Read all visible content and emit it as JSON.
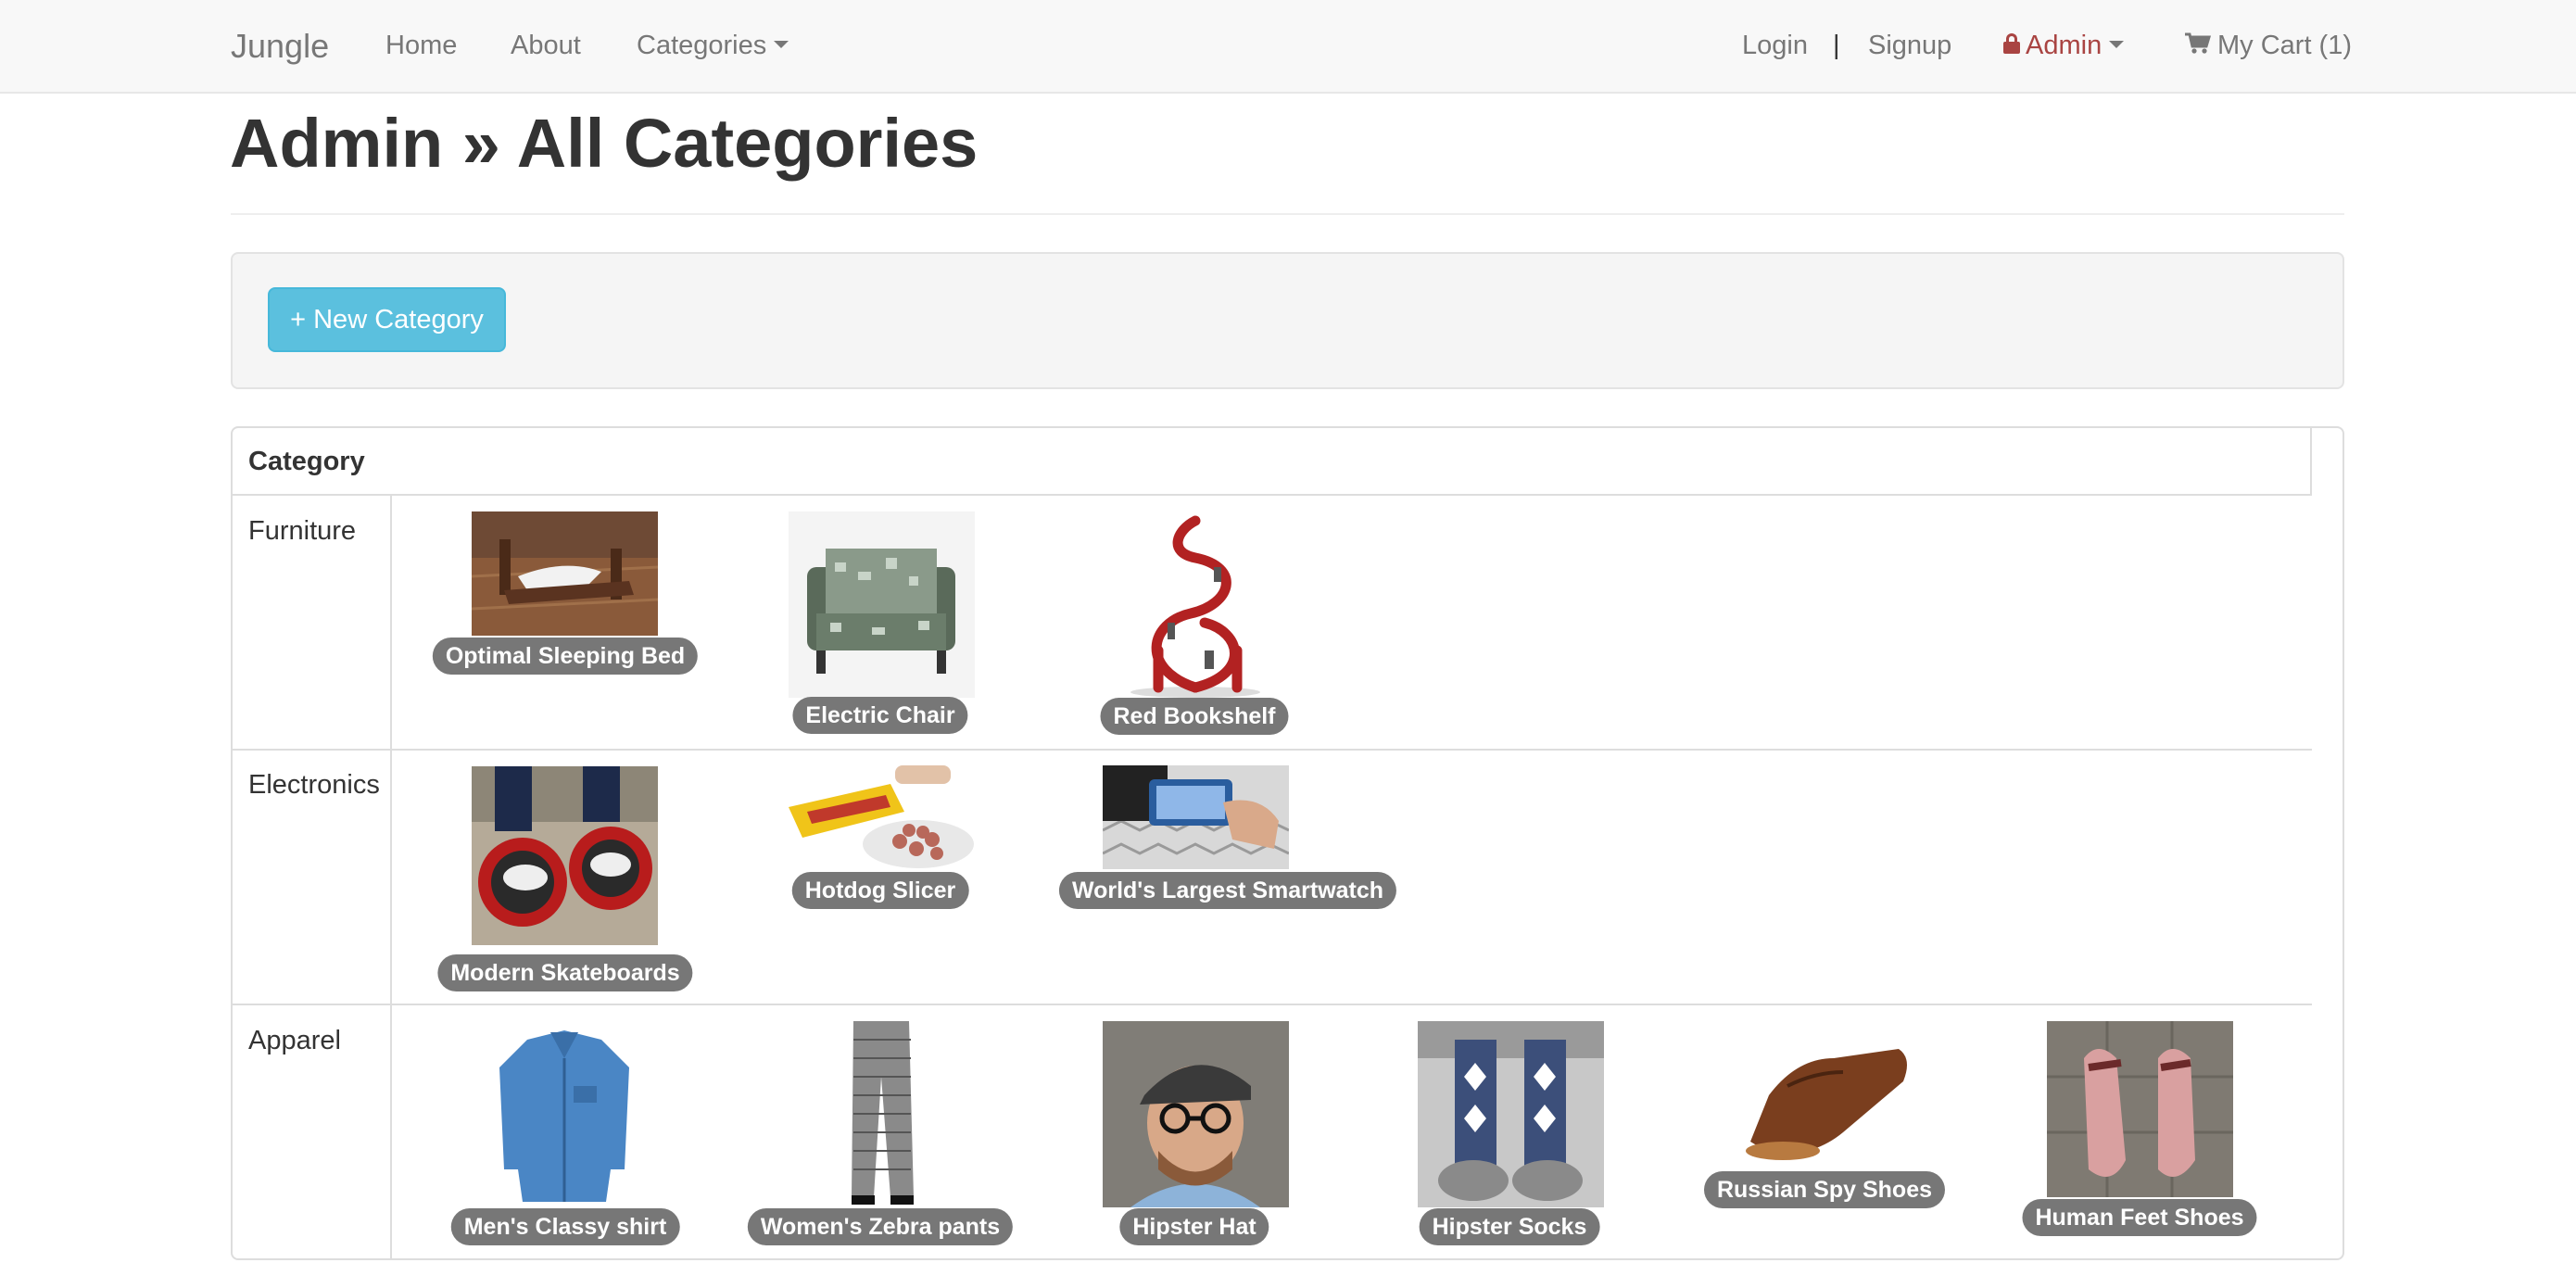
{
  "navbar": {
    "brand": "Jungle",
    "home": "Home",
    "about": "About",
    "categories": "Categories",
    "login": "Login",
    "separator": "|",
    "signup": "Signup",
    "admin": "Admin",
    "cart": "My Cart (1)"
  },
  "page": {
    "title": "Admin » All Categories",
    "new_category_button": "+ New Category"
  },
  "table": {
    "header": "Category",
    "rows": [
      {
        "category": "Furniture",
        "products": [
          "Optimal Sleeping Bed",
          "Electric Chair",
          "Red Bookshelf"
        ]
      },
      {
        "category": "Electronics",
        "products": [
          "Modern Skateboards",
          "Hotdog Slicer",
          "World's Largest Smartwatch"
        ]
      },
      {
        "category": "Apparel",
        "products": [
          "Men's Classy shirt",
          "Women's Zebra pants",
          "Hipster Hat",
          "Hipster Socks",
          "Russian Spy Shoes",
          "Human Feet Shoes"
        ]
      }
    ]
  },
  "colors": {
    "navbar_bg": "#f8f8f8",
    "admin_link": "#a94442",
    "button_info": "#5bc0de",
    "badge": "#777777"
  }
}
